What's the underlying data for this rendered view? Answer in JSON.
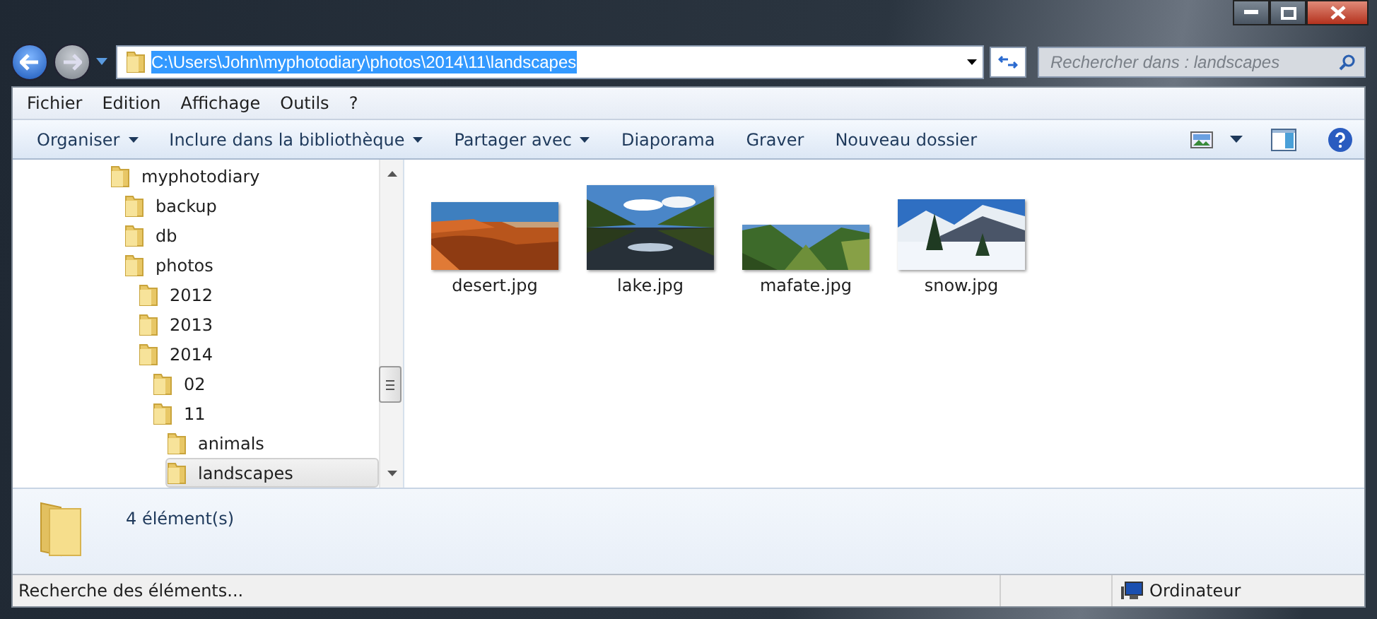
{
  "address": {
    "path": "C:\\Users\\John\\myphotodiary\\photos\\2014\\11\\landscapes",
    "selected": true
  },
  "search": {
    "placeholder": "Rechercher dans : landscapes"
  },
  "menu": [
    "Fichier",
    "Edition",
    "Affichage",
    "Outils",
    "?"
  ],
  "toolbar": [
    {
      "label": "Organiser",
      "dropdown": true
    },
    {
      "label": "Inclure dans la bibliothèque",
      "dropdown": true
    },
    {
      "label": "Partager avec",
      "dropdown": true
    },
    {
      "label": "Diaporama",
      "dropdown": false
    },
    {
      "label": "Graver",
      "dropdown": false
    },
    {
      "label": "Nouveau dossier",
      "dropdown": false
    }
  ],
  "tree": [
    {
      "label": "myphotodiary",
      "selected": false,
      "children": [
        {
          "label": "backup",
          "selected": false
        },
        {
          "label": "db",
          "selected": false
        },
        {
          "label": "photos",
          "selected": false,
          "children": [
            {
              "label": "2012",
              "selected": false
            },
            {
              "label": "2013",
              "selected": false
            },
            {
              "label": "2014",
              "selected": false,
              "children": [
                {
                  "label": "02",
                  "selected": false
                },
                {
                  "label": "11",
                  "selected": false,
                  "children": [
                    {
                      "label": "animals",
                      "selected": false
                    },
                    {
                      "label": "landscapes",
                      "selected": true
                    }
                  ]
                }
              ]
            }
          ]
        }
      ]
    }
  ],
  "files": [
    {
      "name": "desert.jpg",
      "kind": "picture"
    },
    {
      "name": "lake.jpg",
      "kind": "picture"
    },
    {
      "name": "mafate.jpg",
      "kind": "picture"
    },
    {
      "name": "snow.jpg",
      "kind": "picture"
    }
  ],
  "details": {
    "count": "4 élément(s)"
  },
  "status_bar": {
    "message": "Recherche des éléments...",
    "location": "Ordinateur"
  }
}
